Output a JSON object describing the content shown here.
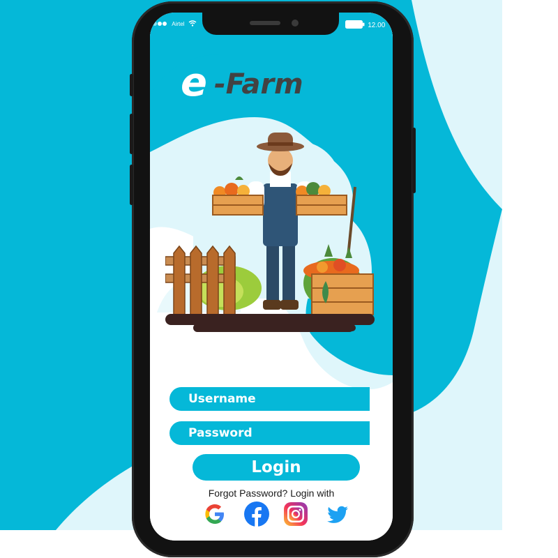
{
  "app": {
    "brand_prefix": "e",
    "brand_name": "-Farm"
  },
  "status_bar": {
    "carrier": "Airtel",
    "time": "12.00",
    "icons": [
      "signal-dots-icon",
      "wifi-icon",
      "battery-icon"
    ]
  },
  "login_form": {
    "username_placeholder": "Username",
    "password_placeholder": "Password",
    "login_label": "Login",
    "alt_login_text": "Forgot Password? Login with"
  },
  "social_logins": [
    {
      "name": "google",
      "icon": "google-icon"
    },
    {
      "name": "facebook",
      "icon": "facebook-icon"
    },
    {
      "name": "instagram",
      "icon": "instagram-icon"
    },
    {
      "name": "twitter",
      "icon": "twitter-icon"
    }
  ],
  "colors": {
    "accent": "#05b8d8",
    "logo_dark": "#424242",
    "background": "#ffffff"
  }
}
